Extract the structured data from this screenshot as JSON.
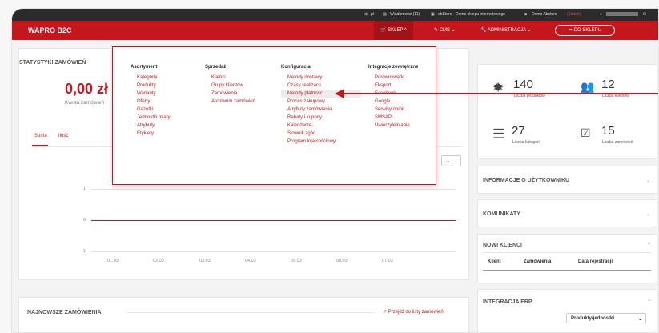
{
  "topbar": {
    "lang": "pl",
    "messages": "Wiadomości (11)",
    "store": "abStore - Demo sklepu internetowego",
    "demo": "Demo Abstore",
    "change": "(Zmień)"
  },
  "header": {
    "brand": "WAPRO B2C",
    "nav_shop": "SKLEP",
    "nav_cms": "CMS",
    "nav_admin": "ADMINISTRACJA",
    "to_shop": "DO SKLEPU"
  },
  "stats_panel": {
    "title": "STATYSTYKI ZAMÓWIEŃ",
    "amount": "0,00 zł",
    "amount_caption": "Kwota zamówień",
    "tab_sum": "Suma",
    "tab_qty": "Ilość",
    "y_ticks": [
      "1",
      "0",
      "-1"
    ],
    "x_ticks": [
      "01.03",
      "02.03",
      "03.03",
      "04.03",
      "05.03",
      "06.03",
      "07.03"
    ]
  },
  "menu": {
    "columns": [
      {
        "heading": "Asortyment",
        "items": [
          "Kategorie",
          "Produkty",
          "Warianty",
          "Oferty",
          "Gazetki",
          "Jednostki miary",
          "Atrybuty",
          "Etykiety"
        ]
      },
      {
        "heading": "Sprzedaż",
        "items": [
          "Klienci",
          "Grupy klientów",
          "Zamówienia",
          "Archiwum zamówień"
        ]
      },
      {
        "heading": "Konfiguracja",
        "items": [
          "Metody dostawy",
          "Czasy realizacji",
          "Metody płatności",
          "Proces zakupowy",
          "Atrybuty zamówienia",
          "Rabaty i kupony",
          "Kalendarze",
          "Słownik zgód",
          "Program lojalnościowy"
        ]
      },
      {
        "heading": "Integracje zewnętrzne",
        "items": [
          "Porównywarki",
          "Eksport",
          "Facebook",
          "Google",
          "Serwisy opinii",
          "SMSAPI",
          "Uwierzytelnianie"
        ]
      }
    ]
  },
  "summary": {
    "products_count": "140",
    "products_label": "Liczba produktów",
    "clients_count": "12",
    "clients_label": "Liczba klientów",
    "categories_count": "27",
    "categories_label": "Liczba kategorii",
    "orders_count": "15",
    "orders_label": "Liczba zamówień"
  },
  "side_panels": {
    "user_info": "INFORMACJE O UŻYTKOWNIKU",
    "messages": "KOMUNIKATY",
    "new_clients": "NOWI KLIENCI",
    "col_client": "Klient",
    "col_orders": "Zamówienia",
    "col_regdate": "Data rejestracji",
    "erp": "INTEGRACJA ERP",
    "erp_select": "Produkty/jednostki"
  },
  "latest_orders": {
    "title": "NAJNOWSZE ZAMÓWIENIA",
    "link": "Przejdź do listy zamówień"
  }
}
